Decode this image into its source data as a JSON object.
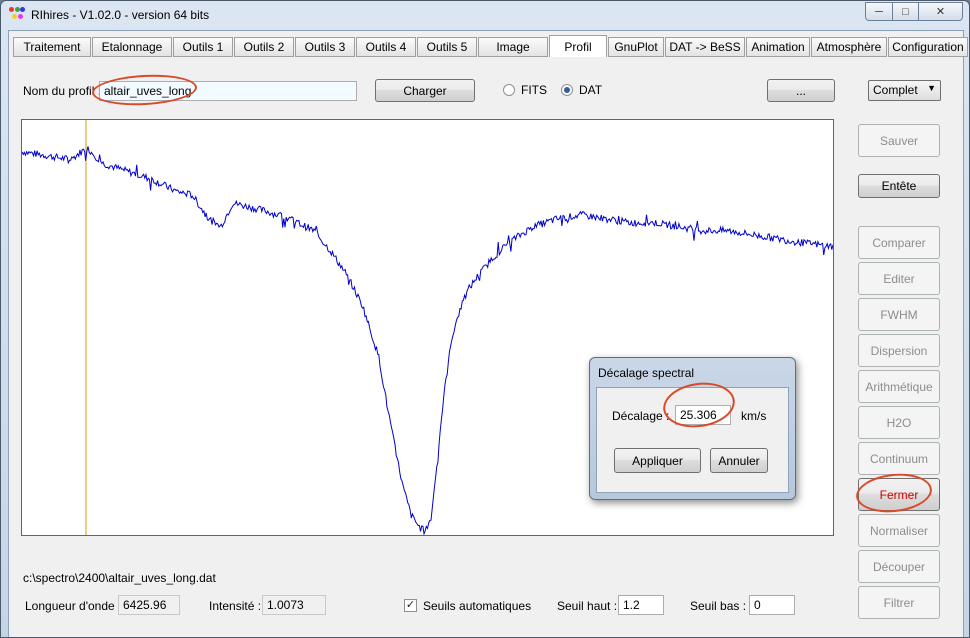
{
  "window": {
    "title": "RIhires - V1.02.0 - version 64 bits"
  },
  "tabs": [
    {
      "label": "Traitement"
    },
    {
      "label": "Etalonnage"
    },
    {
      "label": "Outils 1"
    },
    {
      "label": "Outils 2"
    },
    {
      "label": "Outils 3"
    },
    {
      "label": "Outils 4"
    },
    {
      "label": "Outils 5"
    },
    {
      "label": "Image"
    },
    {
      "label": "Profil"
    },
    {
      "label": "GnuPlot"
    },
    {
      "label": "DAT -> BeSS"
    },
    {
      "label": "Animation"
    },
    {
      "label": "Atmosphère"
    },
    {
      "label": "Configuration"
    }
  ],
  "active_tab": "Profil",
  "profile": {
    "name_label": "Nom du profil :",
    "name_value": "altair_uves_long",
    "load_button": "Charger",
    "radio_fits": "FITS",
    "radio_dat": "DAT",
    "selected_format": "DAT",
    "browse_button": "...",
    "mode_select": "Complet"
  },
  "side_buttons": [
    {
      "label": "Sauver",
      "enabled": false
    },
    {
      "label": "Entête",
      "enabled": true
    },
    {
      "label": "Comparer",
      "enabled": false
    },
    {
      "label": "Editer",
      "enabled": false
    },
    {
      "label": "FWHM",
      "enabled": false
    },
    {
      "label": "Dispersion",
      "enabled": false
    },
    {
      "label": "Arithmétique",
      "enabled": false
    },
    {
      "label": "H2O",
      "enabled": false
    },
    {
      "label": "Continuum",
      "enabled": false
    },
    {
      "label": "Fermer",
      "enabled": true
    },
    {
      "label": "Normaliser",
      "enabled": false
    },
    {
      "label": "Découper",
      "enabled": false
    },
    {
      "label": "Filtrer",
      "enabled": false
    }
  ],
  "status": {
    "file_path": "c:\\spectro\\2400\\altair_uves_long.dat",
    "wavelength_label": "Longueur d'onde :",
    "wavelength_value": "6425.96",
    "intensity_label": "Intensité :",
    "intensity_value": "1.0073",
    "auto_thresholds_label": "Seuils automatiques",
    "auto_thresholds_checked": true,
    "high_label": "Seuil haut :",
    "high_value": "1.2",
    "low_label": "Seuil bas :",
    "low_value": "0"
  },
  "dialog": {
    "title": "Décalage spectral",
    "shift_label": "Décalage :",
    "shift_value": "25.306",
    "unit": "km/s",
    "apply_button": "Appliquer",
    "cancel_button": "Annuler"
  },
  "colors": {
    "spectrum": "#0000cc",
    "cursor_line": "#c8a000",
    "annotation": "#d94a2a",
    "close_text": "#cc0000"
  },
  "chart_data": {
    "type": "line",
    "series": [
      {
        "x": [
          0,
          0.03,
          0.06,
          0.08,
          0.1,
          0.13,
          0.16,
          0.19,
          0.21,
          0.23,
          0.245,
          0.26,
          0.28,
          0.3,
          0.33,
          0.36,
          0.38,
          0.4,
          0.42,
          0.44,
          0.45,
          0.46,
          0.47,
          0.48,
          0.49,
          0.495,
          0.5,
          0.505,
          0.51,
          0.52,
          0.53,
          0.54,
          0.55,
          0.56,
          0.58,
          0.6,
          0.63,
          0.66,
          0.69,
          0.72,
          0.75,
          0.78,
          0.81,
          0.84,
          0.87,
          0.9,
          0.93,
          0.96,
          1.0
        ],
        "y": [
          0.97,
          0.96,
          0.95,
          0.98,
          0.94,
          0.92,
          0.9,
          0.87,
          0.86,
          0.8,
          0.78,
          0.84,
          0.83,
          0.82,
          0.8,
          0.77,
          0.72,
          0.66,
          0.58,
          0.45,
          0.33,
          0.22,
          0.12,
          0.05,
          0.02,
          0.01,
          0.02,
          0.05,
          0.15,
          0.35,
          0.5,
          0.57,
          0.62,
          0.65,
          0.7,
          0.74,
          0.78,
          0.8,
          0.81,
          0.8,
          0.79,
          0.79,
          0.78,
          0.77,
          0.77,
          0.76,
          0.75,
          0.74,
          0.73
        ]
      }
    ],
    "ylim": [
      0,
      1.05
    ]
  }
}
